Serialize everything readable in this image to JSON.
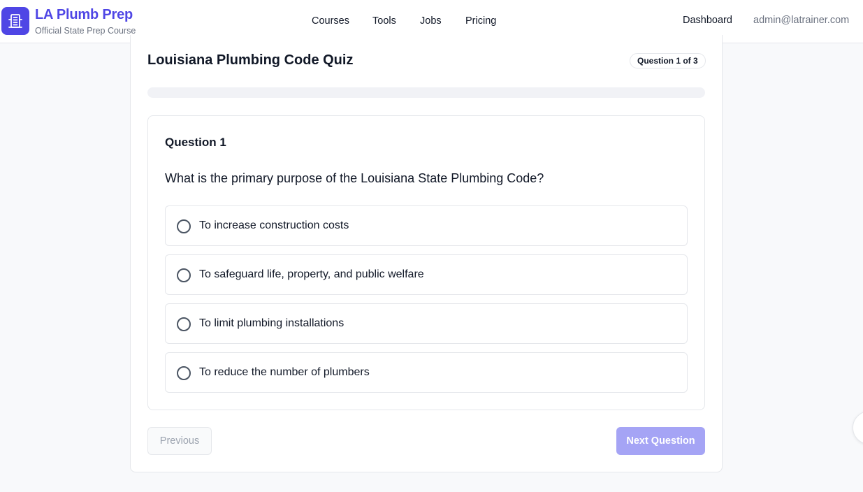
{
  "header": {
    "brand_title": "LA Plumb Prep",
    "brand_subtitle": "Official State Prep Course",
    "logo_icon": "building-icon",
    "nav": [
      "Courses",
      "Tools",
      "Jobs",
      "Pricing"
    ],
    "dashboard_label": "Dashboard",
    "user_email": "admin@latrainer.com"
  },
  "quiz": {
    "title": "Louisiana Plumbing Code Quiz",
    "counter": "Question 1 of 3",
    "progress_fraction": 0,
    "question_heading": "Question 1",
    "question_text": "What is the primary purpose of the Louisiana State Plumbing Code?",
    "options": [
      "To increase construction costs",
      "To safeguard life, property, and public welfare",
      "To limit plumbing installations",
      "To reduce the number of plumbers"
    ],
    "prev_label": "Previous",
    "next_label": "Next Question"
  },
  "colors": {
    "accent": "#4f46e5",
    "next_disabled": "#a5a4f5"
  }
}
